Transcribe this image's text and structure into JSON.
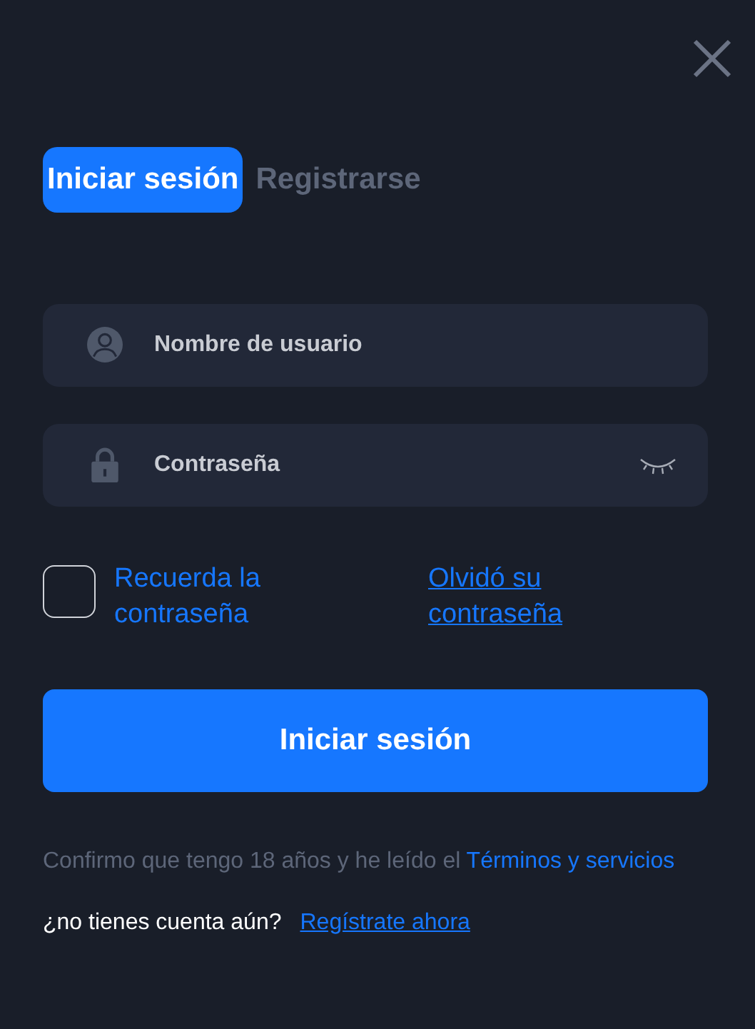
{
  "tabs": [
    {
      "label": "Iniciar sesión",
      "selected": true
    },
    {
      "label": "Registrarse",
      "selected": false
    }
  ],
  "username": {
    "placeholder": "Nombre de usuario"
  },
  "password": {
    "placeholder": "Contraseña"
  },
  "remember": {
    "label": "Recuerda la contraseña",
    "checked": false
  },
  "forgot_link": "Olvidó su contraseña",
  "submit_button": "Iniciar sesión",
  "terms": {
    "text": "Confirmo que tengo 18 años y he leído el ",
    "link": "Términos y servicios"
  },
  "signup": {
    "text": "¿no tienes cuenta aún?",
    "link": "Regístrate ahora"
  }
}
